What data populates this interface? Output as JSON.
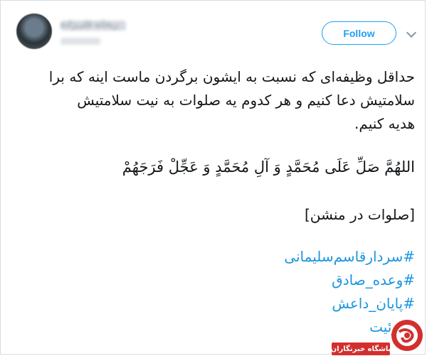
{
  "tweet": {
    "author": {
      "display_name": "ریحانه قلی‌زاده"
    },
    "follow_label": "Follow",
    "lines": [
      "حداقل وظیفه‌ای که نسبت به ایشون برگردن ماست اینه که برا",
      "سلامتیش دعا کنیم و هر کدوم یه صلوات به نیت سلامتیش",
      "هدیه کنیم."
    ],
    "prayer": "اللهُمَّ صَلِّ عَلَی مُحَمَّدٍ وَ آلِ مُحَمَّدٍ وَ عَجِّلْ فَرَجَهُمْ",
    "salawat_note": "[صلوات در منشن]",
    "hashtags": [
      "#سردارقاسم‌سلیمانی",
      "#وعده_صادق",
      "#پایان_داعش",
      "#توئیت"
    ]
  },
  "watermark": {
    "label": "باشگاه خبرنگاران"
  },
  "colors": {
    "accent": "#1da1f2",
    "hashtag": "#1b95e0",
    "watermark": "#d32f2f"
  }
}
